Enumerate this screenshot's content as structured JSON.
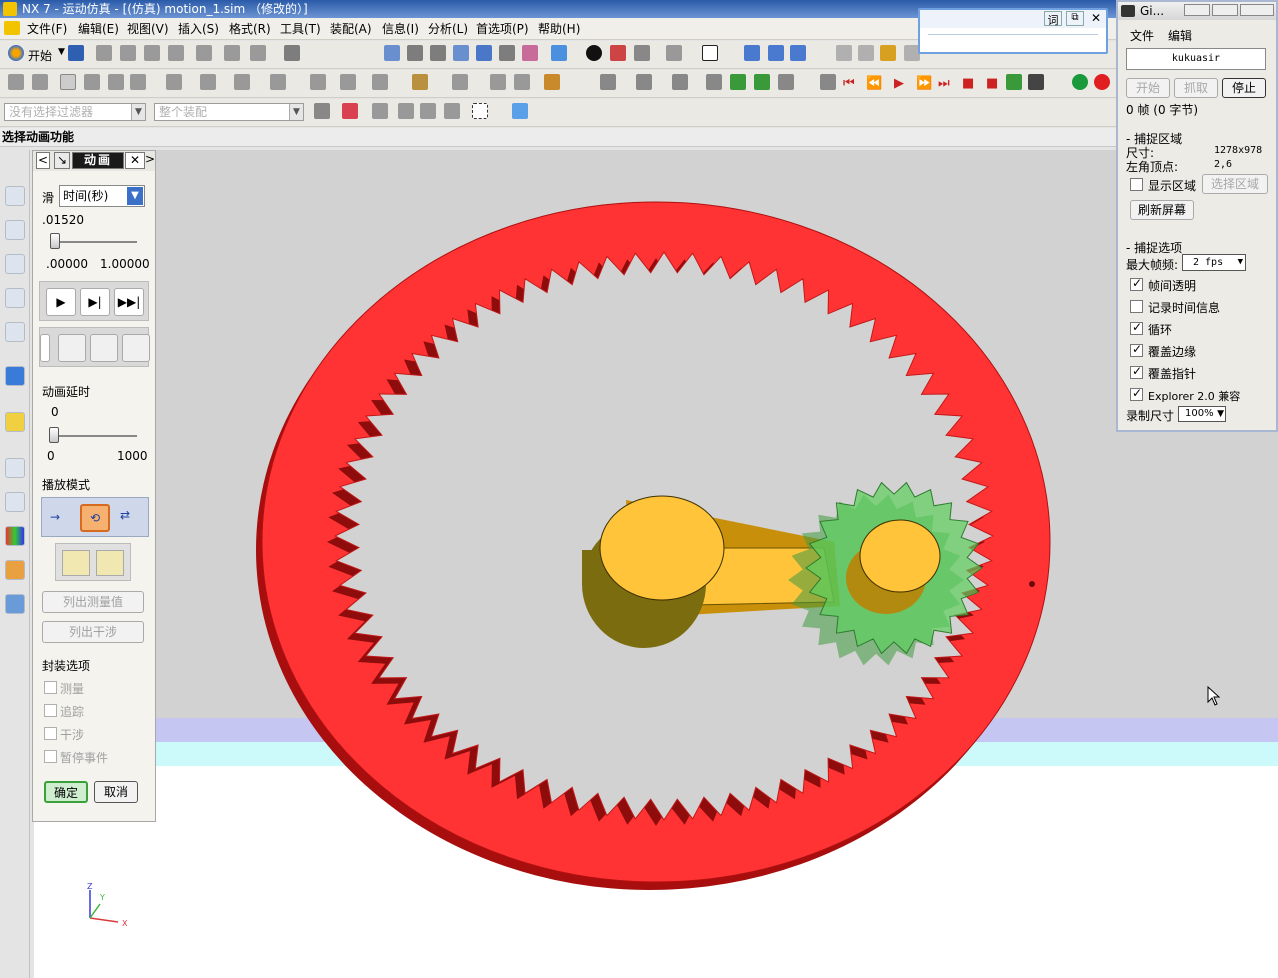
{
  "window_title": "NX 7 - 运动仿真 - [(仿真) motion_1.sim （修改的）]",
  "menubar": [
    "文件(F)",
    "编辑(E)",
    "视图(V)",
    "插入(S)",
    "格式(R)",
    "工具(T)",
    "装配(A)",
    "信息(I)",
    "分析(L)",
    "首选项(P)",
    "帮助(H)"
  ],
  "toolbar": {
    "start_label": "开始"
  },
  "filters": {
    "selection_filter": "没有选择过滤器",
    "scope": "整个装配"
  },
  "cue_line": "选择动画功能",
  "animation_panel": {
    "title": "动画",
    "slider_label": "滑",
    "slider_unit": "时间(秒)",
    "time_value": ".01520",
    "time_fraction": 0.0152,
    "range_min": ".00000",
    "range_max": "1.00000",
    "delay_label": "动画延时",
    "delay_value": "0",
    "delay_min": "0",
    "delay_max": "1000",
    "delay_fraction": 0,
    "playback_mode_label": "播放模式",
    "list_measure_button": "列出测量值",
    "list_interference_button": "列出干涉",
    "encapsulation_label": "封装选项",
    "options": [
      {
        "label": "测量",
        "checked": false
      },
      {
        "label": "追踪",
        "checked": false
      },
      {
        "label": "干涉",
        "checked": false
      },
      {
        "label": "暂停事件",
        "checked": false
      }
    ],
    "ok_button": "确定",
    "cancel_button": "取消"
  },
  "capture_window": {
    "title": "Gi...",
    "menu": [
      "文件",
      "编辑"
    ],
    "user": "kukuasir",
    "buttons": {
      "start": "开始",
      "grab": "抓取",
      "stop": "停止"
    },
    "frame_info": "0 帧 (0 字节)",
    "capture_area_header": "捕捉区域",
    "size_label": "尺寸:",
    "size_value": "1278x978",
    "origin_label": "左角顶点:",
    "origin_value": "2,6",
    "show_area_label": "显示区域",
    "select_area_button": "选择区域",
    "refresh_button": "刷新屏幕",
    "capture_options_header": "捕捉选项",
    "max_fps_label": "最大帧频:",
    "max_fps_value": "2 fps",
    "checks": [
      {
        "label": "帧间透明",
        "checked": true
      },
      {
        "label": "记录时间信息",
        "checked": false
      },
      {
        "label": "循环",
        "checked": true
      },
      {
        "label": "覆盖边缘",
        "checked": true
      },
      {
        "label": "覆盖指针",
        "checked": true
      },
      {
        "label": "Explorer 2.0 兼容",
        "checked": true
      }
    ],
    "record_size_label": "录制尺寸",
    "record_size_value": "100%"
  },
  "popup": {
    "btn1": "词"
  },
  "triad": {
    "x": "X",
    "y": "Y",
    "z": "Z"
  },
  "colors": {
    "ring_gear": "#ff3333",
    "planet_gear": "#5ccf5c",
    "carrier": "#ffc43a",
    "title_bar": "#2a5aa8"
  }
}
